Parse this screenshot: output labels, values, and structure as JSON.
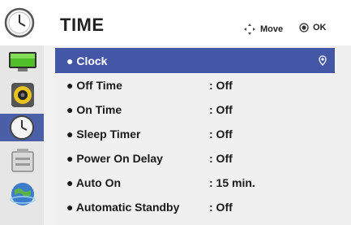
{
  "header": {
    "title": "TIME",
    "move_label": "Move",
    "ok_label": "OK"
  },
  "side_icons": [
    {
      "name": "picture-icon"
    },
    {
      "name": "audio-icon"
    },
    {
      "name": "time-icon",
      "selected": true
    },
    {
      "name": "option-icon"
    },
    {
      "name": "network-icon"
    }
  ],
  "menu": {
    "items": [
      {
        "label": "● Clock",
        "value": ""
      },
      {
        "label": "● Off Time",
        "value": ": Off"
      },
      {
        "label": "● On Time",
        "value": ": Off"
      },
      {
        "label": "● Sleep Timer",
        "value": ": Off"
      },
      {
        "label": "● Power On Delay",
        "value": ": Off"
      },
      {
        "label": "● Auto On",
        "value": ": 15 min."
      },
      {
        "label": "● Automatic Standby",
        "value": ": Off"
      }
    ]
  },
  "colors": {
    "selected_row": "#4457a6",
    "selected_icon_bg": "#4a5fa8",
    "panel_bg": "#f0f0f0",
    "strip_bg": "#e6e6e6"
  }
}
